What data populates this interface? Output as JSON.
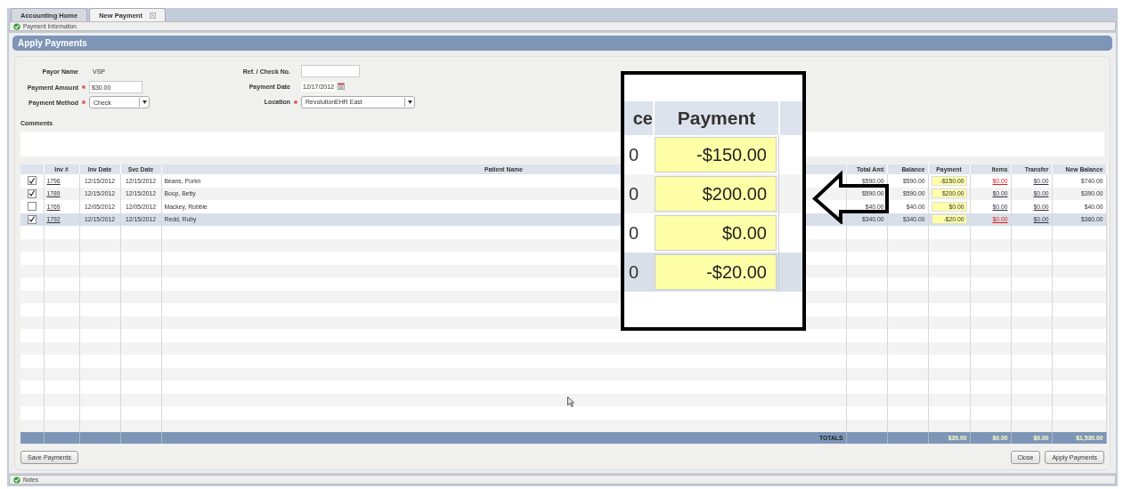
{
  "tabs": [
    {
      "label": "Accounting Home",
      "selected": false,
      "closable": false
    },
    {
      "label": "New Payment",
      "selected": true,
      "closable": true
    }
  ],
  "info_bar": {
    "label": "Payment Information"
  },
  "panel": {
    "title": "Apply Payments"
  },
  "form": {
    "left": [
      {
        "label": "Payor Name",
        "kind": "text",
        "required": false,
        "value": "VSP"
      },
      {
        "label": "Payment Amount",
        "kind": "input",
        "required": true,
        "value": "$30.00"
      },
      {
        "label": "Payment Method",
        "kind": "select",
        "required": true,
        "value": "Check"
      }
    ],
    "right": [
      {
        "label": "Ref. / Check No.",
        "kind": "input",
        "required": false
      },
      {
        "label": "Payment Date",
        "kind": "date",
        "required": false,
        "value": "12/17/2012"
      },
      {
        "label": "Location",
        "kind": "select",
        "required": true,
        "value": "RevolutionEHR East"
      }
    ],
    "comments_label": "Comments"
  },
  "table": {
    "columns": [
      "Inv #",
      "Inv Date",
      "Svc Date",
      "Patient Name",
      "Total Amt",
      "Balance",
      "Payment",
      "Items",
      "Transfer",
      "New Balance"
    ],
    "rows": [
      {
        "checked": true,
        "selected": false,
        "inv": "1796",
        "inv_date": "12/15/2012",
        "svc_date": "12/15/2012",
        "patient": "Beans, Porkn",
        "total": "$590.00",
        "balance": "$590.00",
        "payment": "-$150.00",
        "items": "$0.00",
        "items_flagged": true,
        "transfer": "$0.00",
        "new_balance": "$740.00"
      },
      {
        "checked": true,
        "selected": false,
        "inv": "1789",
        "inv_date": "12/15/2012",
        "svc_date": "12/15/2012",
        "patient": "Boop, Betty",
        "total": "$590.00",
        "balance": "$590.00",
        "payment": "$200.00",
        "items": "$0.00",
        "items_flagged": false,
        "transfer": "$0.00",
        "new_balance": "$390.00"
      },
      {
        "checked": false,
        "selected": false,
        "inv": "1769",
        "inv_date": "12/05/2012",
        "svc_date": "12/05/2012",
        "patient": "Mackey, Robbie",
        "total": "$40.00",
        "balance": "$40.00",
        "payment": "$0.00",
        "items": "$0.00",
        "items_flagged": false,
        "transfer": "$0.00",
        "new_balance": "$40.00"
      },
      {
        "checked": true,
        "selected": true,
        "inv": "1792",
        "inv_date": "12/15/2012",
        "svc_date": "12/15/2012",
        "patient": "Redd, Ruby",
        "total": "$340.00",
        "balance": "$340.00",
        "payment": "-$20.00",
        "items": "$0.00",
        "items_flagged": true,
        "transfer": "$0.00",
        "new_balance": "$360.00"
      }
    ],
    "totals": {
      "label": "TOTALS",
      "payment": "$30.00",
      "items": "$0.00",
      "transfer": "$0.00",
      "new_balance": "$1,530.00"
    }
  },
  "buttons": {
    "left": [
      "Save Payments"
    ],
    "right": [
      "Close",
      "Apply Payments"
    ]
  },
  "notes_bar": {
    "label": "Notes"
  },
  "callout": {
    "header_fragment": "ce",
    "header": "Payment",
    "rows": [
      {
        "fragment": "0",
        "payment": "-$150.00",
        "selected": false
      },
      {
        "fragment": "0",
        "payment": "$200.00",
        "selected": false
      },
      {
        "fragment": "0",
        "payment": "$0.00",
        "selected": false
      },
      {
        "fragment": "0",
        "payment": "-$20.00",
        "selected": true
      }
    ]
  }
}
